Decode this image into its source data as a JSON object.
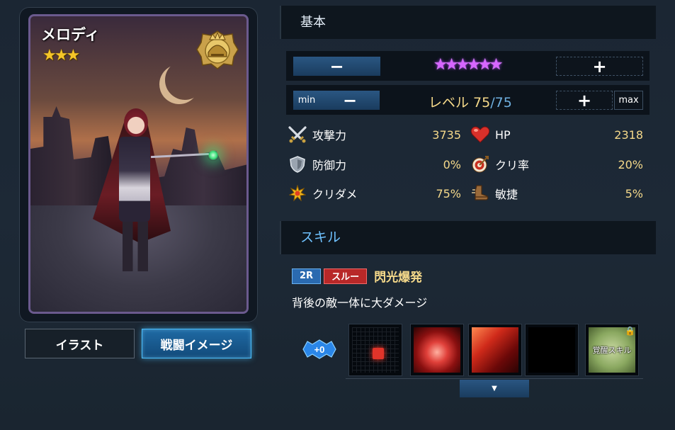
{
  "card": {
    "name": "メロディ",
    "rarity_stars": "★★★",
    "class_emblem": "crowned-helmet-emblem-icon"
  },
  "buttons": {
    "illust": "イラスト",
    "battle_image": "戦闘イメージ"
  },
  "basic": {
    "header": "基本",
    "awaken": {
      "minus": "−",
      "plus": "+",
      "stars": "★★★★★★"
    },
    "level": {
      "min": "min",
      "minus": "−",
      "plus": "+",
      "max": "max",
      "label": "レベル 75",
      "slash_max": "/75"
    },
    "stats": {
      "attack": {
        "label": "攻撃力",
        "value": "3735",
        "icon": "crossed-swords-icon"
      },
      "defense": {
        "label": "防御力",
        "value": "0%",
        "icon": "shield-icon"
      },
      "crit_damage": {
        "label": "クリダメ",
        "value": "75%",
        "icon": "starburst-icon"
      },
      "hp": {
        "label": "HP",
        "value": "2318",
        "icon": "heart-icon"
      },
      "crit_rate": {
        "label": "クリ率",
        "value": "20%",
        "icon": "target-icon"
      },
      "agility": {
        "label": "敏捷",
        "value": "5%",
        "icon": "boot-icon"
      }
    }
  },
  "skill": {
    "header": "スキル",
    "turn_tag": "2R",
    "type_tag": "スルー",
    "name": "閃光爆発",
    "description": "背後の敵一体に大ダメージ",
    "plus_badge": "+0",
    "awaken_slot_label": "覚醒スキル"
  },
  "colors": {
    "accent_blue": "#4ac0ff",
    "value_gold": "#f5d98a",
    "star_purple": "#d766ff",
    "tag_red": "#b82828",
    "tag_blue": "#2a6ab0"
  }
}
